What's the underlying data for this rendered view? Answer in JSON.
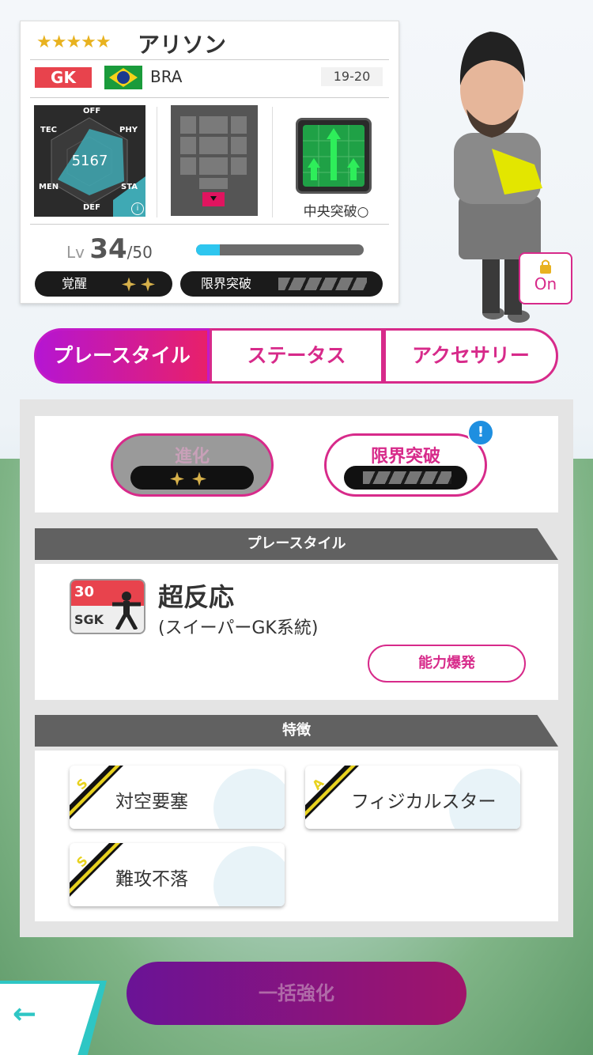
{
  "player": {
    "stars": "★★★★★",
    "name": "アリソン",
    "position": "GK",
    "nationality": "BRA",
    "season": "19-20",
    "flag_icon": "brazil-flag-icon",
    "overall": "5167",
    "radar_labels": {
      "off": "OFF",
      "phy": "PHY",
      "sta": "STA",
      "def": "DEF",
      "men": "MEN",
      "tec": "TEC"
    },
    "tactic_label": "中央突破○",
    "level_prefix": "Lv",
    "level": "34",
    "level_max": "/50",
    "exp_fraction": 0.14,
    "awakening_label": "覚醒",
    "limit_break_label": "限界突破",
    "lock_label": "On"
  },
  "tabs": [
    "プレースタイル",
    "ステータス",
    "アクセサリー"
  ],
  "evolution": {
    "label": "進化",
    "limit_label": "限界突破",
    "badge": "!"
  },
  "playstyle": {
    "header": "プレースタイル",
    "icon_number": "30",
    "icon_code": "SGK",
    "name": "超反応",
    "sub": "(スイーパーGK系統)",
    "ability_button": "能力爆発"
  },
  "features": {
    "header": "特徴",
    "items": [
      {
        "rank": "S",
        "name": "対空要塞"
      },
      {
        "rank": "A",
        "name": "フィジカルスター"
      },
      {
        "rank": "S",
        "name": "難攻不落"
      }
    ]
  },
  "bottom": {
    "bulk_button": "一括強化",
    "back_icon": "back-arrow-icon"
  },
  "colors": {
    "accent": "#d72a8a",
    "position": "#e8434d",
    "exp": "#2ec6ef"
  }
}
